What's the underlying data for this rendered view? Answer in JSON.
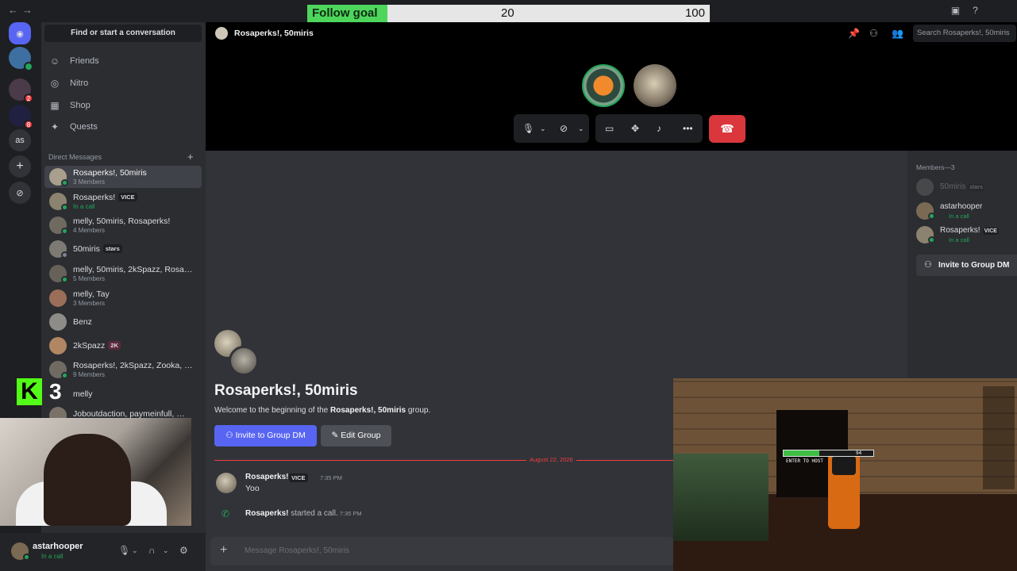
{
  "stream_overlay": {
    "follow_goal_label": "Follow goal",
    "follow_goal_current": "20",
    "follow_goal_target": "100",
    "follow_goal_progress": 0.2,
    "kick_logo_letter": "K",
    "kick_viewer_count": "3"
  },
  "titlebar": {
    "back_icon": "arrow-left-icon",
    "forward_icon": "arrow-right-icon",
    "inbox_icon": "inbox-icon",
    "help_icon": "help-icon"
  },
  "sidebar": {
    "search_placeholder": "Find or start a conversation",
    "nav": [
      {
        "label": "Friends",
        "icon": "friends-icon"
      },
      {
        "label": "Nitro",
        "icon": "nitro-icon"
      },
      {
        "label": "Shop",
        "icon": "shop-icon"
      },
      {
        "label": "Quests",
        "icon": "quests-icon"
      }
    ],
    "dm_header": "Direct Messages",
    "dms": [
      {
        "name": "Rosaperks!, 50miris",
        "sub": "3 Members"
      },
      {
        "name": "Rosaperks!",
        "tag": "VICE",
        "sub": "In a call"
      },
      {
        "name": "melly, 50miris, Rosaperks!",
        "sub": "4 Members"
      },
      {
        "name": "50miris",
        "tag": "stars"
      },
      {
        "name": "melly, 50miris, 2kSpazz, Rosaperks!…",
        "sub": "5 Members"
      },
      {
        "name": "melly, Tay",
        "sub": "3 Members"
      },
      {
        "name": "Benz"
      },
      {
        "name": "2kSpazz",
        "tag": "2K"
      },
      {
        "name": "Rosaperks!, 2kSpazz, Zooka, Ko…",
        "sub": "9 Members"
      },
      {
        "name": "melly"
      },
      {
        "name": "Joboutdaction, paymeinfull, …"
      }
    ]
  },
  "user_panel": {
    "username": "astarhooper",
    "status": "In a call"
  },
  "header": {
    "title": "Rosaperks!, 50miris",
    "search_placeholder": "Search Rosaperks!, 50miris"
  },
  "welcome": {
    "title": "Rosaperks!, 50miris",
    "text_prefix": "Welcome to the beginning of the ",
    "text_group": "Rosaperks!, 50miris",
    "text_suffix": " group.",
    "invite_button": "Invite to Group DM",
    "edit_button": "Edit Group"
  },
  "messages": {
    "date_divider": "August 22, 2026",
    "author": "Rosaperks!",
    "author_tag": "VICE",
    "time": "7:35 PM",
    "body": "Yoo",
    "system_author": "Rosaperks!",
    "system_text": " started a call.",
    "system_time": "7:35 PM"
  },
  "composer": {
    "placeholder": "Message Rosaperks!, 50miris"
  },
  "members": {
    "header": "Members—3",
    "list": [
      {
        "name": "50miris",
        "tag": "stars",
        "status": ""
      },
      {
        "name": "astarhooper",
        "tag": "",
        "status": "In a call"
      },
      {
        "name": "Rosaperks!",
        "tag": "VICE",
        "status": "In a call"
      }
    ],
    "invite_button": "Invite to Group DM"
  },
  "game_hud": {
    "label": "ENTER TO HOST",
    "value": "94"
  },
  "colors": {
    "blurple": "#5865f2",
    "online": "#23a55a",
    "danger": "#da373c",
    "kick_green": "#53fc18",
    "follow_fill": "#4ed65c"
  }
}
